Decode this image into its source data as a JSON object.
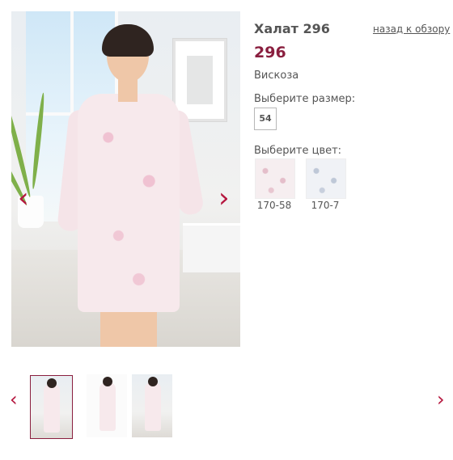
{
  "product": {
    "title": "Халат 296",
    "back_link": "назад к обзору",
    "price": "296",
    "material": "Вискоза"
  },
  "size": {
    "label": "Выберите размер:",
    "options": [
      "54"
    ]
  },
  "color": {
    "label": "Выберите цвет:",
    "options": [
      {
        "caption": "170-58",
        "tone": "#f6eef0"
      },
      {
        "caption": "170-7",
        "tone": "#f0f2f6"
      }
    ]
  },
  "gallery": {
    "prev_icon": "‹",
    "next_icon": "›",
    "thumbnail_count": 3,
    "active_thumbnail": 1
  },
  "colors": {
    "accent": "#b5163e",
    "price": "#8a1f3f",
    "text": "#555555"
  }
}
